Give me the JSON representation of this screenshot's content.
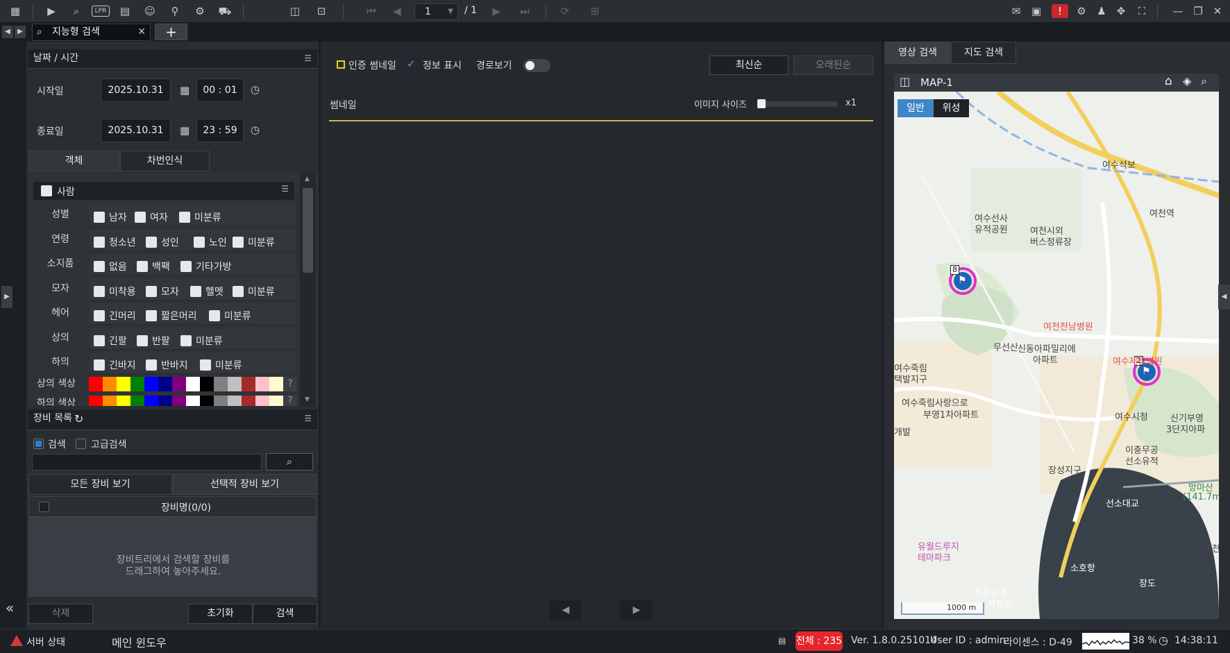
{
  "toolbar": {
    "page_current": "1",
    "page_total": "/ 1",
    "lpr_label": "LPR"
  },
  "tabs": {
    "active_tab": "지능형 검색"
  },
  "left": {
    "datetime_header": "날짜 / 시간",
    "start_label": "시작일",
    "start_date": "2025.10.31",
    "start_time": "00 : 01",
    "end_label": "종료일",
    "end_date": "2025.10.31",
    "end_time": "23 : 59",
    "subtab_object": "객체",
    "subtab_plate": "차번인식",
    "person_header": "사람",
    "attributes": [
      {
        "label": "성별",
        "options": [
          "남자",
          "여자",
          "미분류"
        ]
      },
      {
        "label": "연령",
        "options": [
          "청소년",
          "성인",
          "노인",
          "미분류"
        ]
      },
      {
        "label": "소지품",
        "options": [
          "없음",
          "백팩",
          "기타가방"
        ]
      },
      {
        "label": "모자",
        "options": [
          "미착용",
          "모자",
          "헬멧",
          "미분류"
        ]
      },
      {
        "label": "헤어",
        "options": [
          "긴머리",
          "짧은머리",
          "미분류"
        ]
      },
      {
        "label": "상의",
        "options": [
          "긴팔",
          "반팔",
          "미분류"
        ]
      },
      {
        "label": "하의",
        "options": [
          "긴바지",
          "반바지",
          "미분류"
        ]
      }
    ],
    "top_color_label": "상의 색상",
    "bottom_color_label": "하의 색상",
    "colors": [
      "#ff0000",
      "#ff8c00",
      "#ffff00",
      "#008000",
      "#0000ff",
      "#00008b",
      "#800080",
      "#ffffff",
      "#000000",
      "#808080",
      "#c0c0c0",
      "#a52a2a",
      "#ffc0cb",
      "#fffacd"
    ],
    "device_header": "장비 목록",
    "radio_search": "검색",
    "radio_advanced": "고급검색",
    "tab_all_devices": "모든 장비 보기",
    "tab_selected_devices": "선택적 장비 보기",
    "device_col": "장비명(0/0)",
    "drop_hint_1": "장비트리에서 검색할 장비를",
    "drop_hint_2": "드래그하여 놓아주세요.",
    "delete": "삭제",
    "reset": "초기화",
    "search": "검색"
  },
  "center": {
    "cert_thumb": "인증 썸네일",
    "info_display": "정보 표시",
    "route_view": "경로보기",
    "latest": "최신순",
    "oldest": "오래된순",
    "thumbnail": "썸네일",
    "image_size": "이미지 사이즈",
    "zoom": "x1",
    "image_size_level": 0
  },
  "right": {
    "tab_video": "영상 검색",
    "tab_map": "지도 검색",
    "map_name": "MAP-1",
    "map_normal": "일반",
    "map_satellite": "위성",
    "scale": "1000 m",
    "markers": [
      {
        "count": "8"
      },
      {
        "count": "2"
      }
    ],
    "places": [
      "여수석보",
      "여천역",
      "여수선사",
      "유적공원",
      "여천시외",
      "버스정류장",
      "여천전남병원",
      "무선산",
      "신동아파밀리에",
      "아파트",
      "여수제일병원",
      "여수죽림사랑으로",
      "부영1차아파트",
      "여수시청",
      "신기부영",
      "3단지아파",
      "장성지구",
      "이충무공",
      "선소유적",
      "망마산",
      "(141.7m",
      "선소대교",
      "유월드루지",
      "테마파크",
      "소호항",
      "주운금호",
      "아파트",
      "장도",
      "여수죽림",
      "택발지구",
      "개발",
      "웅천"
    ]
  },
  "status": {
    "server": "서버 상태",
    "main_window": "메인 윈도우",
    "total": "전체 : 235",
    "version": "Ver. 1.8.0.251014",
    "user": "User ID : admin",
    "license": "라이센스 : D-49",
    "cpu": "38 %",
    "time": "14:38:11"
  }
}
